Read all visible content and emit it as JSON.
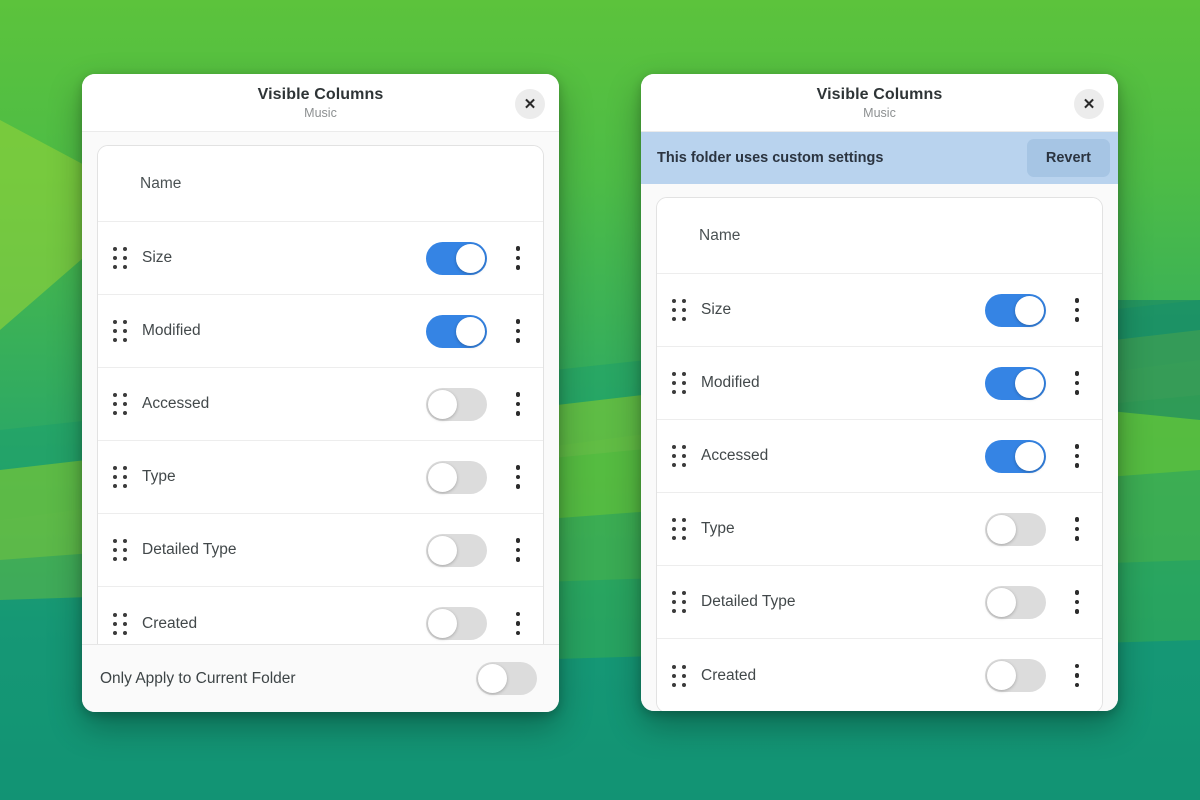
{
  "wallpaper": {
    "gradient_top": "#5cc33c",
    "gradient_bottom": "#0f9079"
  },
  "theme": {
    "toggle_on_color": "#3584e4",
    "toggle_off_color": "#dcdcdc",
    "banner_bg": "#b9d3ee",
    "banner_button_bg": "#a6c5e4"
  },
  "dialog_left": {
    "title": "Visible Columns",
    "subtitle": "Music",
    "close_icon": "close-icon",
    "close_glyph": "✕",
    "rows": [
      {
        "label": "Name",
        "has_handle": false,
        "has_toggle": false,
        "has_menu": false,
        "on": false
      },
      {
        "label": "Size",
        "has_handle": true,
        "has_toggle": true,
        "has_menu": true,
        "on": true
      },
      {
        "label": "Modified",
        "has_handle": true,
        "has_toggle": true,
        "has_menu": true,
        "on": true
      },
      {
        "label": "Accessed",
        "has_handle": true,
        "has_toggle": true,
        "has_menu": true,
        "on": false
      },
      {
        "label": "Type",
        "has_handle": true,
        "has_toggle": true,
        "has_menu": true,
        "on": false
      },
      {
        "label": "Detailed Type",
        "has_handle": true,
        "has_toggle": true,
        "has_menu": true,
        "on": false
      },
      {
        "label": "Created",
        "has_handle": true,
        "has_toggle": true,
        "has_menu": true,
        "on": false
      }
    ],
    "footer": {
      "label": "Only Apply to Current Folder",
      "on": false
    }
  },
  "dialog_right": {
    "title": "Visible Columns",
    "subtitle": "Music",
    "close_icon": "close-icon",
    "close_glyph": "✕",
    "banner": {
      "text": "This folder uses custom settings",
      "button_label": "Revert"
    },
    "rows": [
      {
        "label": "Name",
        "has_handle": false,
        "has_toggle": false,
        "has_menu": false,
        "on": false
      },
      {
        "label": "Size",
        "has_handle": true,
        "has_toggle": true,
        "has_menu": true,
        "on": true
      },
      {
        "label": "Modified",
        "has_handle": true,
        "has_toggle": true,
        "has_menu": true,
        "on": true
      },
      {
        "label": "Accessed",
        "has_handle": true,
        "has_toggle": true,
        "has_menu": true,
        "on": true
      },
      {
        "label": "Type",
        "has_handle": true,
        "has_toggle": true,
        "has_menu": true,
        "on": false
      },
      {
        "label": "Detailed Type",
        "has_handle": true,
        "has_toggle": true,
        "has_menu": true,
        "on": false
      },
      {
        "label": "Created",
        "has_handle": true,
        "has_toggle": true,
        "has_menu": true,
        "on": false
      }
    ]
  }
}
